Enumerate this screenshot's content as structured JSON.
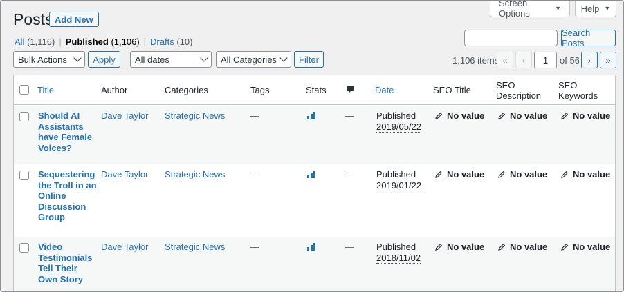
{
  "header": {
    "title": "Posts",
    "add_new": "Add New",
    "screen_options": "Screen Options",
    "help": "Help"
  },
  "views": {
    "all_label": "All",
    "all_count": "(1,116)",
    "published_label": "Published",
    "published_count": "(1,106)",
    "drafts_label": "Drafts",
    "drafts_count": "(10)",
    "separator": "|"
  },
  "search": {
    "placeholder": "",
    "button": "Search Posts"
  },
  "filters": {
    "bulk_actions": "Bulk Actions",
    "apply": "Apply",
    "dates": "All dates",
    "categories": "All Categories",
    "filter": "Filter"
  },
  "pagination": {
    "items": "1,106 items",
    "first": "«",
    "prev": "‹",
    "current_page": "1",
    "of_pages": "of 56",
    "next": "›",
    "last": "»"
  },
  "columns": {
    "title": "Title",
    "author": "Author",
    "categories": "Categories",
    "tags": "Tags",
    "stats": "Stats",
    "comments_icon": "comment-bubble-icon",
    "date": "Date",
    "seo_title": "SEO Title",
    "seo_description_1": "SEO",
    "seo_description_2": "Description",
    "seo_keywords_1": "SEO",
    "seo_keywords_2": "Keywords"
  },
  "rows": [
    {
      "title_lines": [
        "Should AI",
        "Assistants",
        "have Female",
        "Voices?"
      ],
      "author": "Dave Taylor",
      "category": "Strategic News",
      "tags": "—",
      "comments": "—",
      "status": "Published",
      "date": "2019/05/22",
      "seo_title": "No value",
      "seo_description": "No value",
      "seo_keywords": "No value"
    },
    {
      "title_lines": [
        "Sequestering",
        "the Troll in an",
        "Online",
        "Discussion",
        "Group"
      ],
      "author": "Dave Taylor",
      "category": "Strategic News",
      "tags": "—",
      "comments": "—",
      "status": "Published",
      "date": "2019/01/22",
      "seo_title": "No value",
      "seo_description": "No value",
      "seo_keywords": "No value"
    },
    {
      "title_lines": [
        "Video",
        "Testimonials",
        "Tell Their",
        "Own Story"
      ],
      "author": "Dave Taylor",
      "category": "Strategic News",
      "tags": "—",
      "comments": "—",
      "status": "Published",
      "date": "2018/11/02",
      "seo_title": "No value",
      "seo_description": "No value",
      "seo_keywords": "No value"
    }
  ],
  "colors": {
    "accent": "#2271b1",
    "background": "#f0f0f1",
    "row_alt": "#f6f7f7"
  }
}
